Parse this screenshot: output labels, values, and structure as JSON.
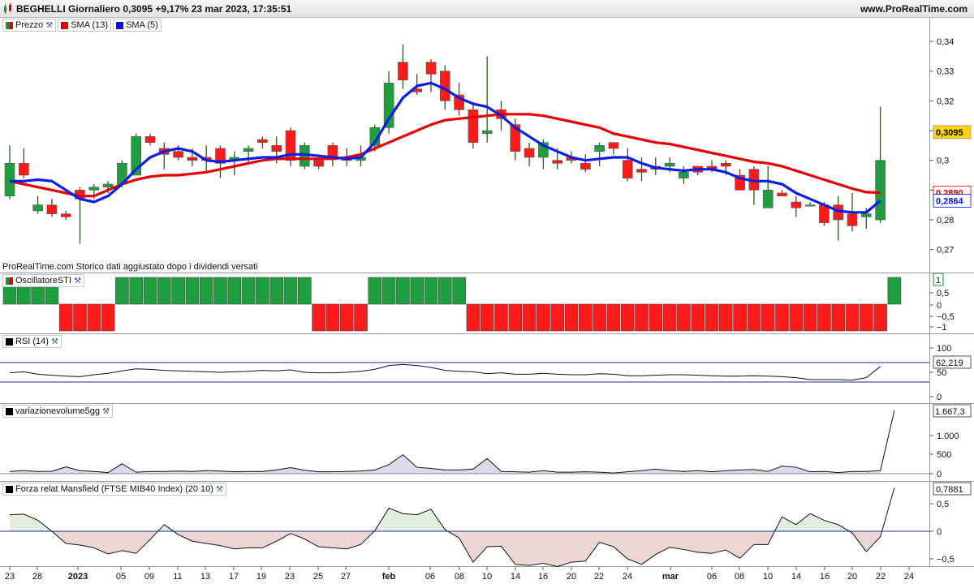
{
  "titlebar": {
    "title": "BEGHELLI Giornaliero 0,3095 +9,17% 23 mar 2023, 17:35:51",
    "site": "www.ProRealTime.com"
  },
  "price_pane": {
    "legend": [
      {
        "label": "Prezzo",
        "color": "#1e8f3a",
        "icon": "candles-icon"
      },
      {
        "label": "SMA (13)",
        "color": "#e00000"
      },
      {
        "label": "SMA (5)",
        "color": "#0015e0"
      }
    ],
    "axis_ticks": [
      "0,34",
      "0,33",
      "0,32",
      "0,31",
      "0,3",
      "0,29",
      "0,28",
      "0,27"
    ],
    "badges": [
      {
        "text": "0,3095",
        "value": 0.3095,
        "bg": "#ffd400",
        "fg": "#000000"
      },
      {
        "text": "0,2890",
        "value": 0.2891,
        "bg": "#ffffff",
        "fg": "#e00000"
      },
      {
        "text": "0,2864",
        "value": 0.2864,
        "bg": "#ffffff",
        "fg": "#0015e0"
      }
    ],
    "footnote": "ProRealTime.com  Storico dati aggiustato dopo i dividendi versati"
  },
  "sti_pane": {
    "legend": "OscillatoreSTI",
    "axis_ticks": [
      "0,5",
      "0",
      "−0,5",
      "−1"
    ],
    "badge": "1",
    "up_color": "#1e8f3a",
    "down_color": "#e00000"
  },
  "rsi_pane": {
    "legend": "RSI (14)",
    "axis_ticks": [
      "100",
      "50",
      "0"
    ],
    "badge": "62,219"
  },
  "vol_pane": {
    "legend": "variazionevolume5gg",
    "axis_ticks": [
      "1.000",
      "500",
      "0"
    ],
    "badge": "1.667,3"
  },
  "mansfield_pane": {
    "legend": "Forza relat Mansfield (FTSE MIB40 Index) (20 10)",
    "axis_ticks": [
      "0,5",
      "0",
      "−0,5"
    ],
    "badge": "0,7881"
  },
  "xaxis": {
    "labels": [
      "23",
      "28",
      "2023",
      "05",
      "09",
      "11",
      "13",
      "17",
      "19",
      "23",
      "25",
      "27",
      "feb",
      "06",
      "08",
      "10",
      "14",
      "16",
      "20",
      "22",
      "24",
      "mar",
      "06",
      "08",
      "10",
      "14",
      "16",
      "20",
      "22",
      "24"
    ]
  },
  "chart_data": [
    {
      "type": "candlestick",
      "title": "BEGHELLI Giornaliero",
      "ylim": [
        0.268,
        0.343
      ],
      "series_names": [
        "Prezzo",
        "SMA (13)",
        "SMA (5)"
      ],
      "x": [
        "23 dic",
        "27 dic",
        "28 dic",
        "29 dic",
        "30 dic",
        "2 gen",
        "3 gen",
        "4 gen",
        "5 gen",
        "6 gen",
        "9 gen",
        "10 gen",
        "11 gen",
        "12 gen",
        "13 gen",
        "16 gen",
        "17 gen",
        "18 gen",
        "19 gen",
        "20 gen",
        "23 gen",
        "24 gen",
        "25 gen",
        "26 gen",
        "27 gen",
        "30 gen",
        "31 gen",
        "1 feb",
        "2 feb",
        "3 feb",
        "6 feb",
        "7 feb",
        "8 feb",
        "9 feb",
        "10 feb",
        "13 feb",
        "14 feb",
        "15 feb",
        "16 feb",
        "17 feb",
        "20 feb",
        "21 feb",
        "22 feb",
        "23 feb",
        "24 feb",
        "27 feb",
        "28 feb",
        "1 mar",
        "2 mar",
        "3 mar",
        "6 mar",
        "7 mar",
        "8 mar",
        "9 mar",
        "10 mar",
        "13 mar",
        "14 mar",
        "15 mar",
        "16 mar",
        "17 mar",
        "20 mar",
        "21 mar",
        "22 mar",
        "23 mar"
      ],
      "candles": [
        [
          0.288,
          0.299,
          0.305,
          0.287
        ],
        [
          0.299,
          0.295,
          0.304,
          0.294
        ],
        [
          0.283,
          0.285,
          0.288,
          0.282
        ],
        [
          0.285,
          0.282,
          0.287,
          0.281
        ],
        [
          0.282,
          0.281,
          0.283,
          0.28
        ],
        [
          0.29,
          0.287,
          0.291,
          0.272
        ],
        [
          0.29,
          0.291,
          0.292,
          0.287
        ],
        [
          0.291,
          0.292,
          0.293,
          0.289
        ],
        [
          0.292,
          0.299,
          0.3,
          0.291
        ],
        [
          0.295,
          0.308,
          0.309,
          0.295
        ],
        [
          0.308,
          0.306,
          0.309,
          0.305
        ],
        [
          0.304,
          0.302,
          0.306,
          0.297
        ],
        [
          0.303,
          0.301,
          0.305,
          0.3
        ],
        [
          0.301,
          0.3,
          0.304,
          0.298
        ],
        [
          0.301,
          0.3,
          0.305,
          0.296
        ],
        [
          0.304,
          0.299,
          0.305,
          0.294
        ],
        [
          0.3,
          0.301,
          0.303,
          0.295
        ],
        [
          0.303,
          0.304,
          0.305,
          0.299
        ],
        [
          0.307,
          0.306,
          0.308,
          0.304
        ],
        [
          0.305,
          0.303,
          0.308,
          0.299
        ],
        [
          0.31,
          0.3,
          0.311,
          0.298
        ],
        [
          0.298,
          0.305,
          0.306,
          0.297
        ],
        [
          0.3,
          0.298,
          0.302,
          0.297
        ],
        [
          0.305,
          0.301,
          0.306,
          0.298
        ],
        [
          0.301,
          0.3,
          0.304,
          0.298
        ],
        [
          0.3,
          0.301,
          0.305,
          0.298
        ],
        [
          0.305,
          0.311,
          0.312,
          0.303
        ],
        [
          0.311,
          0.326,
          0.33,
          0.309
        ],
        [
          0.333,
          0.327,
          0.339,
          0.324
        ],
        [
          0.324,
          0.323,
          0.329,
          0.322
        ],
        [
          0.333,
          0.329,
          0.334,
          0.323
        ],
        [
          0.33,
          0.32,
          0.332,
          0.317
        ],
        [
          0.322,
          0.317,
          0.326,
          0.315
        ],
        [
          0.317,
          0.306,
          0.319,
          0.304
        ],
        [
          0.309,
          0.31,
          0.335,
          0.306
        ],
        [
          0.317,
          0.314,
          0.32,
          0.31
        ],
        [
          0.312,
          0.303,
          0.314,
          0.3
        ],
        [
          0.304,
          0.301,
          0.306,
          0.298
        ],
        [
          0.301,
          0.306,
          0.307,
          0.297
        ],
        [
          0.3,
          0.299,
          0.304,
          0.297
        ],
        [
          0.301,
          0.3,
          0.303,
          0.299
        ],
        [
          0.299,
          0.297,
          0.302,
          0.296
        ],
        [
          0.303,
          0.305,
          0.306,
          0.298
        ],
        [
          0.306,
          0.304,
          0.306,
          0.302
        ],
        [
          0.3,
          0.294,
          0.304,
          0.293
        ],
        [
          0.297,
          0.296,
          0.301,
          0.293
        ],
        [
          0.298,
          0.297,
          0.301,
          0.295
        ],
        [
          0.298,
          0.299,
          0.301,
          0.296
        ],
        [
          0.294,
          0.296,
          0.298,
          0.292
        ],
        [
          0.298,
          0.296,
          0.298,
          0.295
        ],
        [
          0.298,
          0.297,
          0.3,
          0.296
        ],
        [
          0.299,
          0.298,
          0.3,
          0.295
        ],
        [
          0.295,
          0.29,
          0.297,
          0.29
        ],
        [
          0.297,
          0.29,
          0.298,
          0.285
        ],
        [
          0.284,
          0.29,
          0.298,
          0.284
        ],
        [
          0.289,
          0.288,
          0.29,
          0.288
        ],
        [
          0.286,
          0.284,
          0.288,
          0.281
        ],
        [
          0.285,
          0.285,
          0.286,
          0.285
        ],
        [
          0.285,
          0.279,
          0.286,
          0.278
        ],
        [
          0.285,
          0.28,
          0.288,
          0.273
        ],
        [
          0.282,
          0.278,
          0.289,
          0.276
        ],
        [
          0.281,
          0.282,
          0.284,
          0.277
        ],
        [
          0.28,
          0.3,
          0.318,
          0.279
        ]
      ],
      "sma13": [
        0.293,
        0.292,
        0.291,
        0.29,
        0.289,
        0.288,
        0.288,
        0.29,
        0.292,
        0.2935,
        0.2945,
        0.295,
        0.295,
        0.2955,
        0.296,
        0.297,
        0.298,
        0.299,
        0.3,
        0.3005,
        0.3005,
        0.3005,
        0.3005,
        0.3005,
        0.301,
        0.302,
        0.304,
        0.306,
        0.308,
        0.31,
        0.312,
        0.3135,
        0.314,
        0.3145,
        0.315,
        0.3155,
        0.3155,
        0.3155,
        0.315,
        0.314,
        0.313,
        0.312,
        0.311,
        0.309,
        0.308,
        0.307,
        0.306,
        0.3055,
        0.3045,
        0.3035,
        0.3025,
        0.3015,
        0.3005,
        0.2995,
        0.299,
        0.298,
        0.2965,
        0.295,
        0.2935,
        0.292,
        0.2905,
        0.2893,
        0.2891
      ],
      "sma5": [
        0.293,
        0.293,
        0.2935,
        0.293,
        0.29,
        0.287,
        0.286,
        0.288,
        0.292,
        0.297,
        0.301,
        0.303,
        0.304,
        0.303,
        0.3,
        0.2995,
        0.3,
        0.3005,
        0.301,
        0.301,
        0.302,
        0.302,
        0.3015,
        0.301,
        0.3005,
        0.301,
        0.306,
        0.314,
        0.321,
        0.325,
        0.326,
        0.324,
        0.321,
        0.319,
        0.318,
        0.315,
        0.311,
        0.308,
        0.305,
        0.303,
        0.301,
        0.3,
        0.3005,
        0.301,
        0.301,
        0.299,
        0.2975,
        0.297,
        0.2965,
        0.297,
        0.297,
        0.296,
        0.294,
        0.293,
        0.293,
        0.292,
        0.289,
        0.287,
        0.285,
        0.283,
        0.2825,
        0.2825,
        0.2864
      ]
    },
    {
      "type": "bar",
      "title": "OscillatoreSTI",
      "ylim": [
        -1.2,
        1.2
      ],
      "values": [
        1,
        1,
        1,
        1,
        -1,
        -1,
        -1,
        -1,
        1,
        1,
        1,
        1,
        1,
        1,
        1,
        1,
        1,
        1,
        1,
        1,
        1,
        1,
        -1,
        -1,
        -1,
        -1,
        1,
        1,
        1,
        1,
        1,
        1,
        1,
        -1,
        -1,
        -1,
        -1,
        -1,
        -1,
        -1,
        -1,
        -1,
        -1,
        -1,
        -1,
        -1,
        -1,
        -1,
        -1,
        -1,
        -1,
        -1,
        -1,
        -1,
        -1,
        -1,
        -1,
        -1,
        -1,
        -1,
        -1,
        -1,
        -1,
        1
      ]
    },
    {
      "type": "line",
      "title": "RSI (14)",
      "ylim": [
        0,
        100
      ],
      "levels": [
        70,
        30
      ],
      "values": [
        49,
        51,
        46,
        44,
        42,
        41,
        45,
        48,
        53,
        57,
        56,
        54,
        53,
        52,
        51,
        50,
        51,
        52,
        54,
        53,
        55,
        50,
        49,
        49,
        50,
        52,
        56,
        64,
        66,
        64,
        60,
        54,
        52,
        51,
        47,
        49,
        46,
        46,
        48,
        46,
        45,
        45,
        47,
        46,
        43,
        43,
        44,
        45,
        45,
        44,
        43,
        42,
        42,
        43,
        42,
        41,
        39,
        35,
        35,
        35,
        34,
        39,
        62
      ]
    },
    {
      "type": "area",
      "title": "variazionevolume5gg",
      "ylim": [
        -50,
        1750
      ],
      "values": [
        60,
        80,
        60,
        65,
        180,
        80,
        60,
        30,
        260,
        40,
        60,
        60,
        70,
        60,
        80,
        70,
        50,
        60,
        60,
        100,
        160,
        90,
        50,
        50,
        60,
        70,
        100,
        240,
        500,
        170,
        140,
        100,
        100,
        120,
        400,
        60,
        50,
        40,
        80,
        40,
        40,
        50,
        40,
        20,
        50,
        80,
        120,
        80,
        60,
        80,
        50,
        80,
        100,
        110,
        60,
        200,
        170,
        50,
        60,
        30,
        60,
        60,
        80,
        1667.3
      ]
    },
    {
      "type": "area",
      "title": "Forza relat Mansfield (FTSE MIB40 Index) (20 10)",
      "ylim": [
        -0.75,
        1.0
      ],
      "values": [
        0.3,
        0.31,
        0.2,
        0.0,
        -0.22,
        -0.25,
        -0.3,
        -0.41,
        -0.35,
        -0.4,
        -0.15,
        0.12,
        -0.06,
        -0.18,
        -0.22,
        -0.26,
        -0.32,
        -0.3,
        -0.3,
        -0.18,
        -0.04,
        -0.14,
        -0.28,
        -0.3,
        -0.32,
        -0.24,
        0.01,
        0.42,
        0.32,
        0.3,
        0.4,
        0.03,
        -0.12,
        -0.56,
        -0.28,
        -0.27,
        -0.6,
        -0.62,
        -0.58,
        -0.64,
        -0.56,
        -0.54,
        -0.2,
        -0.28,
        -0.5,
        -0.6,
        -0.42,
        -0.29,
        -0.33,
        -0.38,
        -0.4,
        -0.34,
        -0.49,
        -0.24,
        -0.24,
        0.26,
        0.12,
        0.32,
        0.2,
        0.12,
        -0.03,
        -0.37,
        -0.1,
        0.7881
      ]
    }
  ]
}
